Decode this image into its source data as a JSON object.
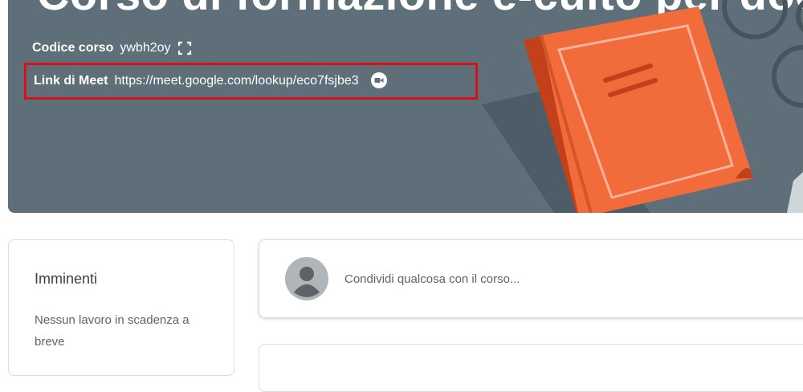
{
  "header": {
    "course_title": "Corso di formazione e-culto per docenti",
    "class_code_label": "Codice corso",
    "class_code_value": "ywbh2oy",
    "meet_link_label": "Link di Meet",
    "meet_link_value": "https://meet.google.com/lookup/eco7fsjbe3",
    "icons": {
      "class_code": "fullscreen-icon",
      "meet": "meet-video-icon"
    },
    "colors": {
      "banner": "#5e6f7a",
      "highlight_border": "#d8101a",
      "book": "#f26b3a"
    }
  },
  "upcoming": {
    "title": "Imminenti",
    "empty_text": "Nessun lavoro in scadenza a breve"
  },
  "stream": {
    "share_placeholder": "Condividi qualcosa con il corso..."
  }
}
